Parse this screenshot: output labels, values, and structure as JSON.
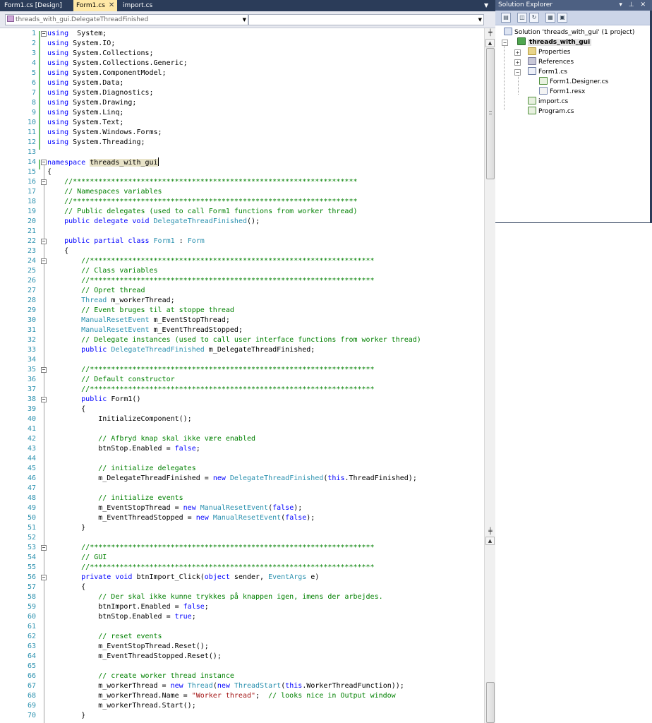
{
  "tabs": [
    {
      "label": "Form1.cs [Design]",
      "active": false
    },
    {
      "label": "Form1.cs",
      "active": true
    },
    {
      "label": "import.cs",
      "active": false
    }
  ],
  "tab_close_glyph": "✕",
  "navbar": {
    "left_combo": "threads_with_gui.DelegateThreadFinished",
    "right_combo": ""
  },
  "solution_explorer": {
    "title": "Solution Explorer",
    "title_buttons": "▾ ⊥ ✕",
    "solution_label": "Solution 'threads_with_gui' (1 project)",
    "project_label": "threads_with_gui",
    "items": {
      "properties": "Properties",
      "references": "References",
      "form1": "Form1.cs",
      "form1_designer": "Form1.Designer.cs",
      "form1_resx": "Form1.resx",
      "import": "import.cs",
      "program": "Program.cs"
    }
  },
  "colors": {
    "keyword": "#0000ff",
    "type": "#2b91af",
    "comment": "#008000",
    "string": "#a31515",
    "line_number": "#2b91af"
  },
  "code_lines": [
    {
      "n": "1",
      "tokens": [
        [
          "k",
          "using"
        ],
        [
          "",
          "  System;"
        ]
      ]
    },
    {
      "n": "2",
      "tokens": [
        [
          "k",
          "using"
        ],
        [
          "",
          " System.IO;"
        ]
      ]
    },
    {
      "n": "3",
      "tokens": [
        [
          "k",
          "using"
        ],
        [
          "",
          " System.Collections;"
        ]
      ]
    },
    {
      "n": "4",
      "tokens": [
        [
          "k",
          "using"
        ],
        [
          "",
          " System.Collections.Generic;"
        ]
      ]
    },
    {
      "n": "5",
      "tokens": [
        [
          "k",
          "using"
        ],
        [
          "",
          " System.ComponentModel;"
        ]
      ]
    },
    {
      "n": "6",
      "tokens": [
        [
          "k",
          "using"
        ],
        [
          "",
          " System.Data;"
        ]
      ]
    },
    {
      "n": "7",
      "tokens": [
        [
          "k",
          "using"
        ],
        [
          "",
          " System.Diagnostics;"
        ]
      ]
    },
    {
      "n": "8",
      "tokens": [
        [
          "k",
          "using"
        ],
        [
          "",
          " System.Drawing;"
        ]
      ]
    },
    {
      "n": "9",
      "tokens": [
        [
          "k",
          "using"
        ],
        [
          "",
          " System.Linq;"
        ]
      ]
    },
    {
      "n": "10",
      "tokens": [
        [
          "k",
          "using"
        ],
        [
          "",
          " System.Text;"
        ]
      ]
    },
    {
      "n": "11",
      "tokens": [
        [
          "k",
          "using"
        ],
        [
          "",
          " System.Windows.Forms;"
        ]
      ]
    },
    {
      "n": "12",
      "tokens": [
        [
          "k",
          "using"
        ],
        [
          "",
          " System.Threading;"
        ]
      ]
    },
    {
      "n": "13",
      "tokens": []
    },
    {
      "n": "14",
      "tokens": [
        [
          "k",
          "namespace"
        ],
        [
          "",
          " "
        ],
        [
          "hl",
          "threads_with_gui"
        ]
      ]
    },
    {
      "n": "15",
      "tokens": [
        [
          "",
          "{"
        ]
      ]
    },
    {
      "n": "16",
      "tokens": [
        [
          "c",
          "    //*******************************************************************"
        ]
      ]
    },
    {
      "n": "17",
      "tokens": [
        [
          "c",
          "    // Namespaces variables"
        ]
      ]
    },
    {
      "n": "18",
      "tokens": [
        [
          "c",
          "    //*******************************************************************"
        ]
      ]
    },
    {
      "n": "19",
      "tokens": [
        [
          "c",
          "    // Public delegates (used to call Form1 functions from worker thread)"
        ]
      ]
    },
    {
      "n": "20",
      "tokens": [
        [
          "k",
          "    public delegate void"
        ],
        [
          "",
          " "
        ],
        [
          "t",
          "DelegateThreadFinished"
        ],
        [
          "",
          "();"
        ]
      ]
    },
    {
      "n": "21",
      "tokens": []
    },
    {
      "n": "22",
      "tokens": [
        [
          "k",
          "    public partial class"
        ],
        [
          "",
          " "
        ],
        [
          "t",
          "Form1"
        ],
        [
          "",
          " : "
        ],
        [
          "t",
          "Form"
        ]
      ]
    },
    {
      "n": "23",
      "tokens": [
        [
          "",
          "    {"
        ]
      ]
    },
    {
      "n": "24",
      "tokens": [
        [
          "c",
          "        //*******************************************************************"
        ]
      ]
    },
    {
      "n": "25",
      "tokens": [
        [
          "c",
          "        // Class variables"
        ]
      ]
    },
    {
      "n": "26",
      "tokens": [
        [
          "c",
          "        //*******************************************************************"
        ]
      ]
    },
    {
      "n": "27",
      "tokens": [
        [
          "c",
          "        // Opret thread"
        ]
      ]
    },
    {
      "n": "28",
      "tokens": [
        [
          "t",
          "        Thread"
        ],
        [
          "",
          " m_workerThread;"
        ]
      ]
    },
    {
      "n": "29",
      "tokens": [
        [
          "c",
          "        // Event bruges til at stoppe thread"
        ]
      ]
    },
    {
      "n": "30",
      "tokens": [
        [
          "t",
          "        ManualResetEvent"
        ],
        [
          "",
          " m_EventStopThread;"
        ]
      ]
    },
    {
      "n": "31",
      "tokens": [
        [
          "t",
          "        ManualResetEvent"
        ],
        [
          "",
          " m_EventThreadStopped;"
        ]
      ]
    },
    {
      "n": "32",
      "tokens": [
        [
          "c",
          "        // Delegate instances (used to call user interface functions from worker thread)"
        ]
      ]
    },
    {
      "n": "33",
      "tokens": [
        [
          "k",
          "        public"
        ],
        [
          "",
          " "
        ],
        [
          "t",
          "DelegateThreadFinished"
        ],
        [
          "",
          " m_DelegateThreadFinished;"
        ]
      ]
    },
    {
      "n": "34",
      "tokens": []
    },
    {
      "n": "35",
      "tokens": [
        [
          "c",
          "        //*******************************************************************"
        ]
      ]
    },
    {
      "n": "36",
      "tokens": [
        [
          "c",
          "        // Default constructor"
        ]
      ]
    },
    {
      "n": "37",
      "tokens": [
        [
          "c",
          "        //*******************************************************************"
        ]
      ]
    },
    {
      "n": "38",
      "tokens": [
        [
          "k",
          "        public"
        ],
        [
          "",
          " Form1()"
        ]
      ]
    },
    {
      "n": "39",
      "tokens": [
        [
          "",
          "        {"
        ]
      ]
    },
    {
      "n": "40",
      "tokens": [
        [
          "",
          "            InitializeComponent();"
        ]
      ]
    },
    {
      "n": "41",
      "tokens": []
    },
    {
      "n": "42",
      "tokens": [
        [
          "c",
          "            // Afbryd knap skal ikke være enabled"
        ]
      ]
    },
    {
      "n": "43",
      "tokens": [
        [
          "",
          "            btnStop.Enabled = "
        ],
        [
          "k",
          "false"
        ],
        [
          "",
          ";"
        ]
      ]
    },
    {
      "n": "44",
      "tokens": []
    },
    {
      "n": "45",
      "tokens": [
        [
          "c",
          "            // initialize delegates"
        ]
      ]
    },
    {
      "n": "46",
      "tokens": [
        [
          "",
          "            m_DelegateThreadFinished = "
        ],
        [
          "k",
          "new"
        ],
        [
          "",
          " "
        ],
        [
          "t",
          "DelegateThreadFinished"
        ],
        [
          "",
          "("
        ],
        [
          "k",
          "this"
        ],
        [
          "",
          ".ThreadFinished);"
        ]
      ]
    },
    {
      "n": "47",
      "tokens": []
    },
    {
      "n": "48",
      "tokens": [
        [
          "c",
          "            // initialize events"
        ]
      ]
    },
    {
      "n": "49",
      "tokens": [
        [
          "",
          "            m_EventStopThread = "
        ],
        [
          "k",
          "new"
        ],
        [
          "",
          " "
        ],
        [
          "t",
          "ManualResetEvent"
        ],
        [
          "",
          "("
        ],
        [
          "k",
          "false"
        ],
        [
          "",
          ");"
        ]
      ]
    },
    {
      "n": "50",
      "tokens": [
        [
          "",
          "            m_EventThreadStopped = "
        ],
        [
          "k",
          "new"
        ],
        [
          "",
          " "
        ],
        [
          "t",
          "ManualResetEvent"
        ],
        [
          "",
          "("
        ],
        [
          "k",
          "false"
        ],
        [
          "",
          ");"
        ]
      ]
    },
    {
      "n": "51",
      "tokens": [
        [
          "",
          "        }"
        ]
      ]
    },
    {
      "n": "52",
      "tokens": []
    },
    {
      "n": "53",
      "tokens": [
        [
          "c",
          "        //*******************************************************************"
        ]
      ]
    },
    {
      "n": "54",
      "tokens": [
        [
          "c",
          "        // GUI"
        ]
      ]
    },
    {
      "n": "55",
      "tokens": [
        [
          "c",
          "        //*******************************************************************"
        ]
      ]
    },
    {
      "n": "56",
      "tokens": [
        [
          "k",
          "        private void"
        ],
        [
          "",
          " btnImport_Click("
        ],
        [
          "k",
          "object"
        ],
        [
          "",
          " sender, "
        ],
        [
          "t",
          "EventArgs"
        ],
        [
          "",
          " e)"
        ]
      ]
    },
    {
      "n": "57",
      "tokens": [
        [
          "",
          "        {"
        ]
      ]
    },
    {
      "n": "58",
      "tokens": [
        [
          "c",
          "            // Der skal ikke kunne trykkes på knappen igen, imens der arbejdes."
        ]
      ]
    },
    {
      "n": "59",
      "tokens": [
        [
          "",
          "            btnImport.Enabled = "
        ],
        [
          "k",
          "false"
        ],
        [
          "",
          ";"
        ]
      ]
    },
    {
      "n": "60",
      "tokens": [
        [
          "",
          "            btnStop.Enabled = "
        ],
        [
          "k",
          "true"
        ],
        [
          "",
          ";"
        ]
      ]
    },
    {
      "n": "61",
      "tokens": []
    },
    {
      "n": "62",
      "tokens": [
        [
          "c",
          "            // reset events"
        ]
      ]
    },
    {
      "n": "63",
      "tokens": [
        [
          "",
          "            m_EventStopThread.Reset();"
        ]
      ]
    },
    {
      "n": "64",
      "tokens": [
        [
          "",
          "            m_EventThreadStopped.Reset();"
        ]
      ]
    },
    {
      "n": "65",
      "tokens": []
    },
    {
      "n": "66",
      "tokens": [
        [
          "c",
          "            // create worker thread instance"
        ]
      ]
    },
    {
      "n": "67",
      "tokens": [
        [
          "",
          "            m_workerThread = "
        ],
        [
          "k",
          "new"
        ],
        [
          "",
          " "
        ],
        [
          "t",
          "Thread"
        ],
        [
          "",
          "("
        ],
        [
          "k",
          "new"
        ],
        [
          "",
          " "
        ],
        [
          "t",
          "ThreadStart"
        ],
        [
          "",
          "("
        ],
        [
          "k",
          "this"
        ],
        [
          "",
          ".WorkerThreadFunction));"
        ]
      ]
    },
    {
      "n": "68",
      "tokens": [
        [
          "",
          "            m_workerThread.Name = "
        ],
        [
          "s",
          "\"Worker thread\""
        ],
        [
          "",
          ";  "
        ],
        [
          "c",
          "// looks nice in Output window"
        ]
      ]
    },
    {
      "n": "69",
      "tokens": [
        [
          "",
          "            m_workerThread.Start();"
        ]
      ]
    },
    {
      "n": "70",
      "tokens": [
        [
          "",
          "        }"
        ]
      ]
    }
  ],
  "fold_markers": [
    "1",
    "14",
    "16",
    "22",
    "24",
    "35",
    "38",
    "53",
    "56"
  ]
}
